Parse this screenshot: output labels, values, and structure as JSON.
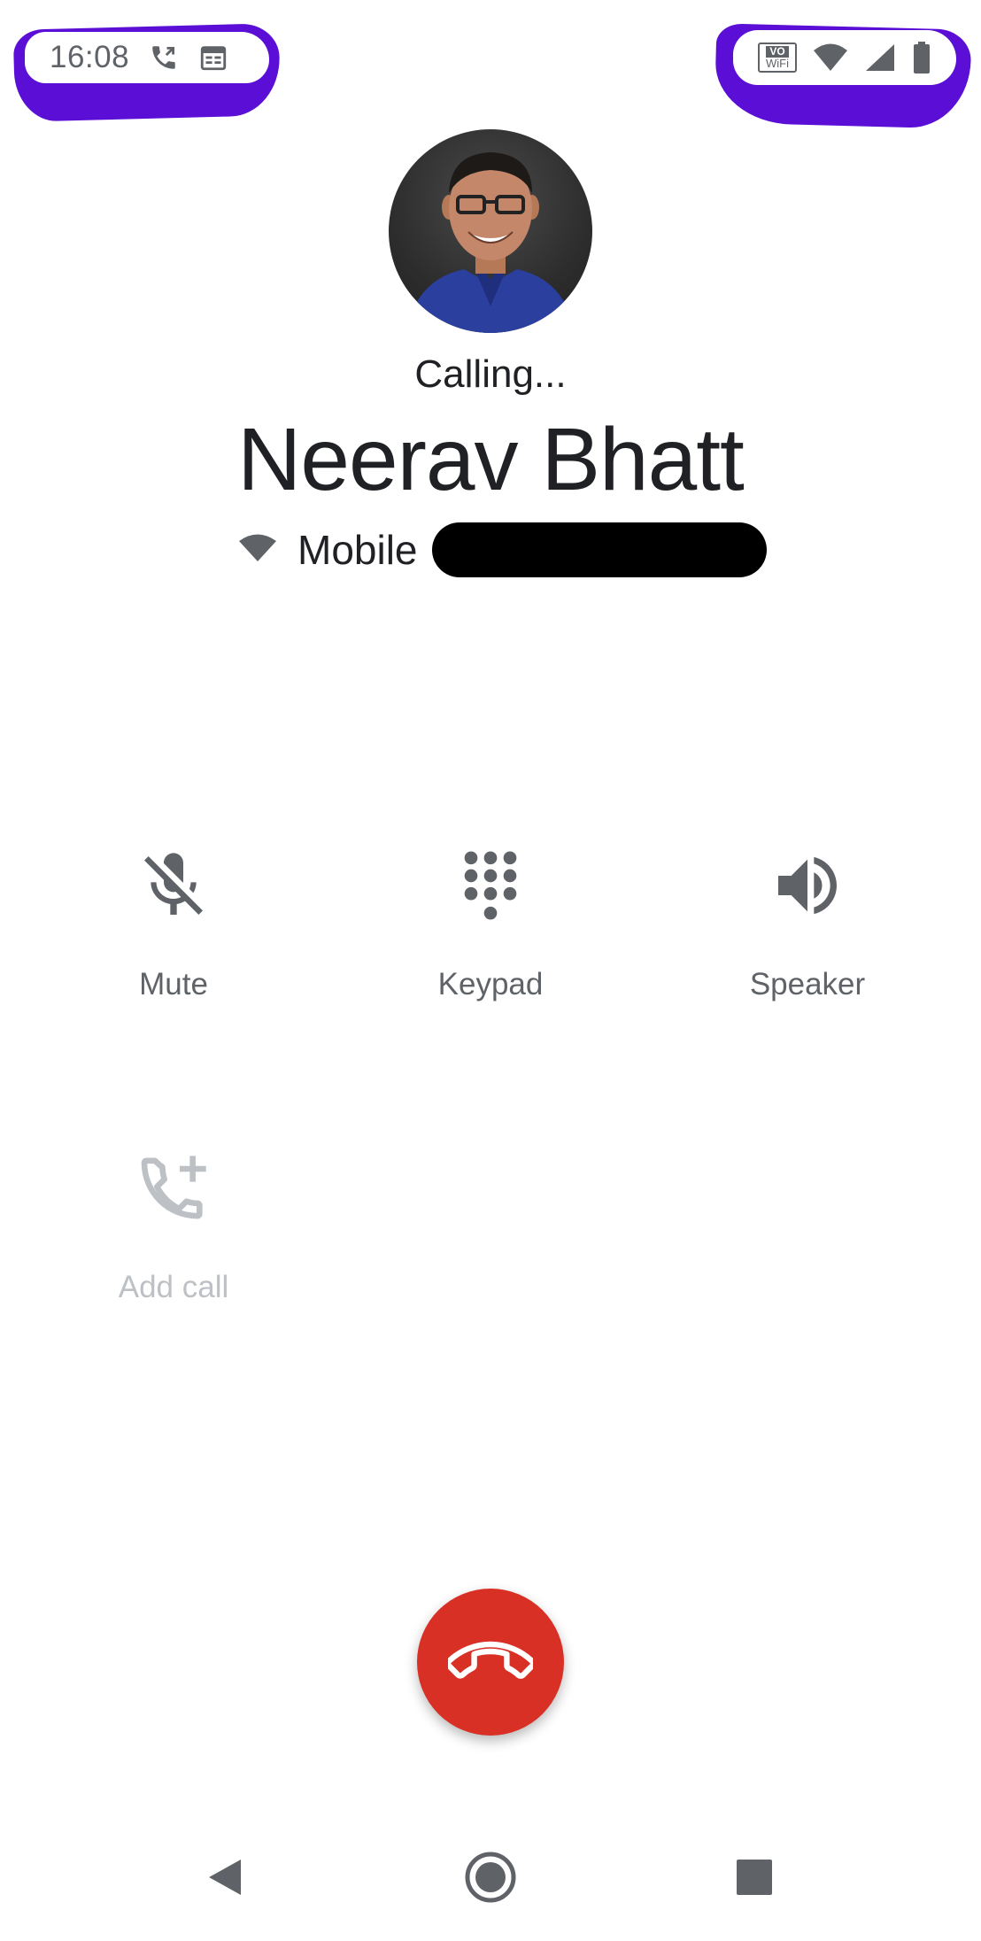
{
  "status_bar": {
    "time": "16:08",
    "left_icons": [
      "call-icon",
      "calendar-icon"
    ],
    "right_icons": [
      "volte-wifi-icon",
      "wifi-icon",
      "cell-signal-icon",
      "battery-icon"
    ],
    "volte_top": "VO",
    "volte_bottom": "WiFi"
  },
  "call": {
    "status": "Calling...",
    "contact_name": "Neerav Bhatt",
    "number_type_icon": "wifi-calling-icon",
    "number_label": "Mobile"
  },
  "controls": [
    {
      "id": "mute",
      "label": "Mute",
      "icon": "mic-off-icon",
      "enabled": true
    },
    {
      "id": "keypad",
      "label": "Keypad",
      "icon": "dialpad-icon",
      "enabled": true
    },
    {
      "id": "speaker",
      "label": "Speaker",
      "icon": "speaker-icon",
      "enabled": true
    },
    {
      "id": "add_call",
      "label": "Add call",
      "icon": "add-call-icon",
      "enabled": false
    }
  ],
  "end_call": {
    "icon": "hang-up-icon",
    "color": "#d93025"
  },
  "nav_bar": {
    "icons": [
      "back-icon",
      "home-icon",
      "recents-icon"
    ]
  },
  "colors": {
    "annotation": "#5b0fd6",
    "icon_gray": "#5f6368",
    "disabled_gray": "#bdc1c6"
  }
}
